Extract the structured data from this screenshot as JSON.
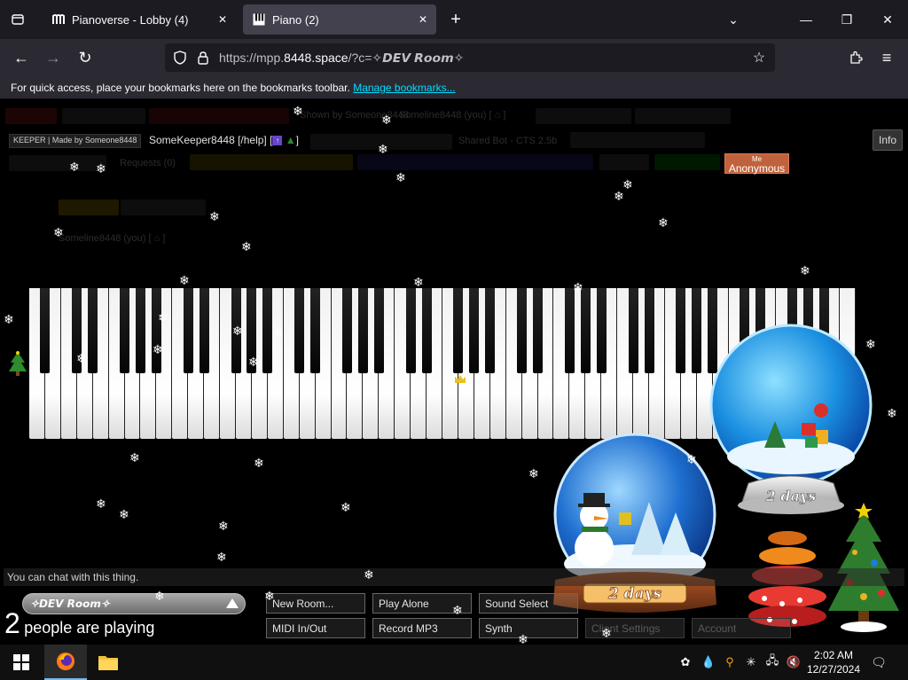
{
  "browser": {
    "tabs": [
      {
        "title": "Pianoverse - Lobby (4)",
        "favicon": "pianoverse-icon",
        "active": false
      },
      {
        "title": "Piano (2)",
        "favicon": "piano-icon",
        "active": true
      }
    ],
    "url_prefix": "https://mpp.",
    "url_domain": "8448.space",
    "url_suffix": "/?c=✧𝘿𝙀𝙑 𝙍𝙤𝙤𝙢✧",
    "bookmarks_text": "For quick access, place your bookmarks here on the bookmarks toolbar.",
    "bookmarks_link": "Manage bookmarks..."
  },
  "page": {
    "keeper_badge": "KEEPER | Made by Someone8448",
    "keeper_name": "SomeKeeper8448 [/help] [",
    "keeper_suffix": "]",
    "info_button": "Info",
    "anon_me": "Me",
    "anon_name": "Anonymous",
    "chat_hint": "You can chat with this thing.",
    "room_name": "✧𝘿𝙀𝙑 𝙍𝙤𝙤𝙢✧",
    "people_count": "2",
    "people_label": "people are playing",
    "buttons": {
      "new_room": "New Room...",
      "play_alone": "Play Alone",
      "sound_select": "Sound Select",
      "midi": "MIDI In/Out",
      "record": "Record MP3",
      "synth": "Synth",
      "client_settings": "Client Settings",
      "account": "Account"
    },
    "dim_texts": {
      "owner_line": "Someline8448 (you) [ ⌂ ]",
      "shown_by": "Shown by Someone8448",
      "shared": "Shared Bot - CTS 2.5b",
      "requests": "Requests (0)",
      "user_line": "Someline8448 (you) [ ⌂ ]"
    },
    "globe_label": "2 days"
  },
  "taskbar": {
    "time": "2:02 AM",
    "date": "12/27/2024"
  },
  "colors": {
    "tab_active": "#42414d",
    "anon": "#c0623d",
    "link": "#00ddff"
  }
}
